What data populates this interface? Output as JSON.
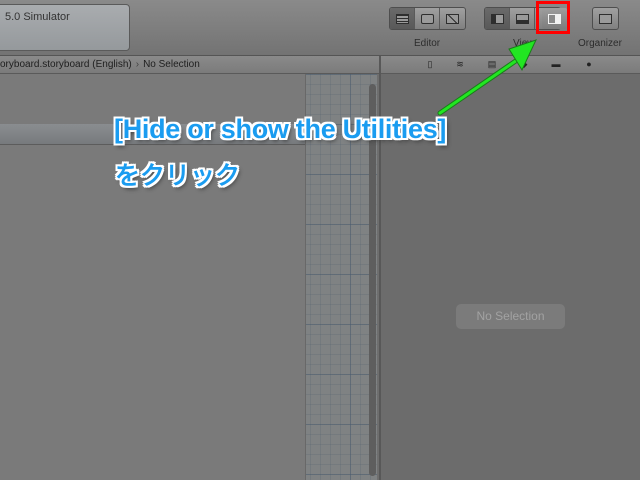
{
  "toolbar": {
    "activity_text": "5.0 Simulator",
    "editor_label": "Editor",
    "view_label": "View",
    "organizer_label": "Organizer",
    "editor_buttons": [
      "standard-editor-icon",
      "assistant-editor-icon",
      "version-editor-icon"
    ],
    "view_buttons": [
      "navigator-toggle-icon",
      "debug-area-toggle-icon",
      "utilities-toggle-icon"
    ],
    "organizer_button": "organizer-icon"
  },
  "jumpbar": {
    "file": "oryboard.storyboard (English)",
    "separator": "›",
    "selection": "No Selection"
  },
  "inspector_tabs": [
    "file-inspector-icon",
    "quick-help-icon",
    "identity-inspector-icon",
    "attributes-inspector-icon",
    "size-inspector-icon",
    "connections-inspector-icon"
  ],
  "utilities": {
    "placeholder": "No Selection"
  },
  "annotation": {
    "line1": "[Hide or show the Utilities]",
    "line2": "をクリック",
    "highlight_color": "#ff0000",
    "text_color": "#1a9cf0",
    "arrow_color": "#22e622"
  }
}
